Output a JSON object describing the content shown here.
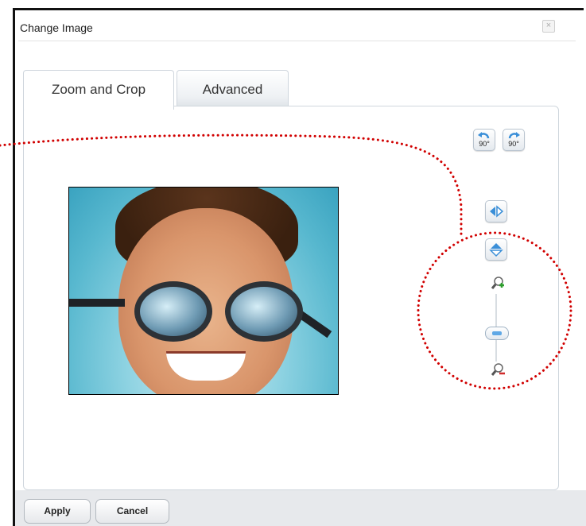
{
  "dialog": {
    "title": "Change Image",
    "close_symbol": "×"
  },
  "tabs": [
    {
      "label": "Zoom and Crop",
      "active": true
    },
    {
      "label": "Advanced",
      "active": false
    }
  ],
  "controls": {
    "rotate_left_label": "90°",
    "rotate_right_label": "90°",
    "zoom_level": 0.4,
    "icons": {
      "rotate_left": "rotate-left-icon",
      "rotate_right": "rotate-right-icon",
      "flip_horizontal": "flip-horizontal-icon",
      "flip_vertical": "flip-vertical-icon",
      "zoom_in": "zoom-in-icon",
      "zoom_out": "zoom-out-icon"
    }
  },
  "footer": {
    "apply_label": "Apply",
    "cancel_label": "Cancel"
  },
  "colors": {
    "annotation": "#d10000",
    "accent": "#5fa8e6"
  }
}
